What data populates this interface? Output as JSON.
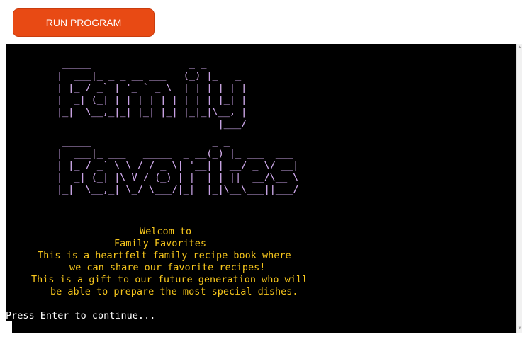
{
  "toolbar": {
    "run_label": "RUN PROGRAM"
  },
  "terminal": {
    "banner_line1": [
      " _____                 _ _       ",
      "|  ___|_ _ _ __ ___   (_) |_   _ ",
      "| |_ / _` | '_ ` _ \\  | | | | | |",
      "|  _| (_| | | | | | | | | | |_| |",
      "|_|  \\__,_|_| |_| |_| |_|_|\\__, |",
      "                            |___/ "
    ],
    "banner_line2": [
      " _____                     _ _            ",
      "|  ___|_ ___   _____  _ __(_) |_ ___  ___ ",
      "| |_ / _` \\ \\ / / _ \\| '__| | __/ _ \\/ __|",
      "|  _| (_| |\\ V / (_) | |  | | ||  __/\\__ \\",
      "|_|  \\__,_| \\_/ \\___/|_|  |_|\\__\\___||___/"
    ],
    "welcome_lines": [
      "Welcom to",
      "Family Favorites",
      "This is a heartfelt family recipe book where",
      "we can share our favorite recipes!",
      "This is a gift to our future generation who will",
      "be able to prepare the most special dishes."
    ],
    "prompt": "Press Enter to continue..."
  },
  "colors": {
    "button": "#e84a14",
    "terminal_bg": "#000000",
    "welcome_text": "#f5c51c",
    "prompt_text": "#ffffff"
  }
}
